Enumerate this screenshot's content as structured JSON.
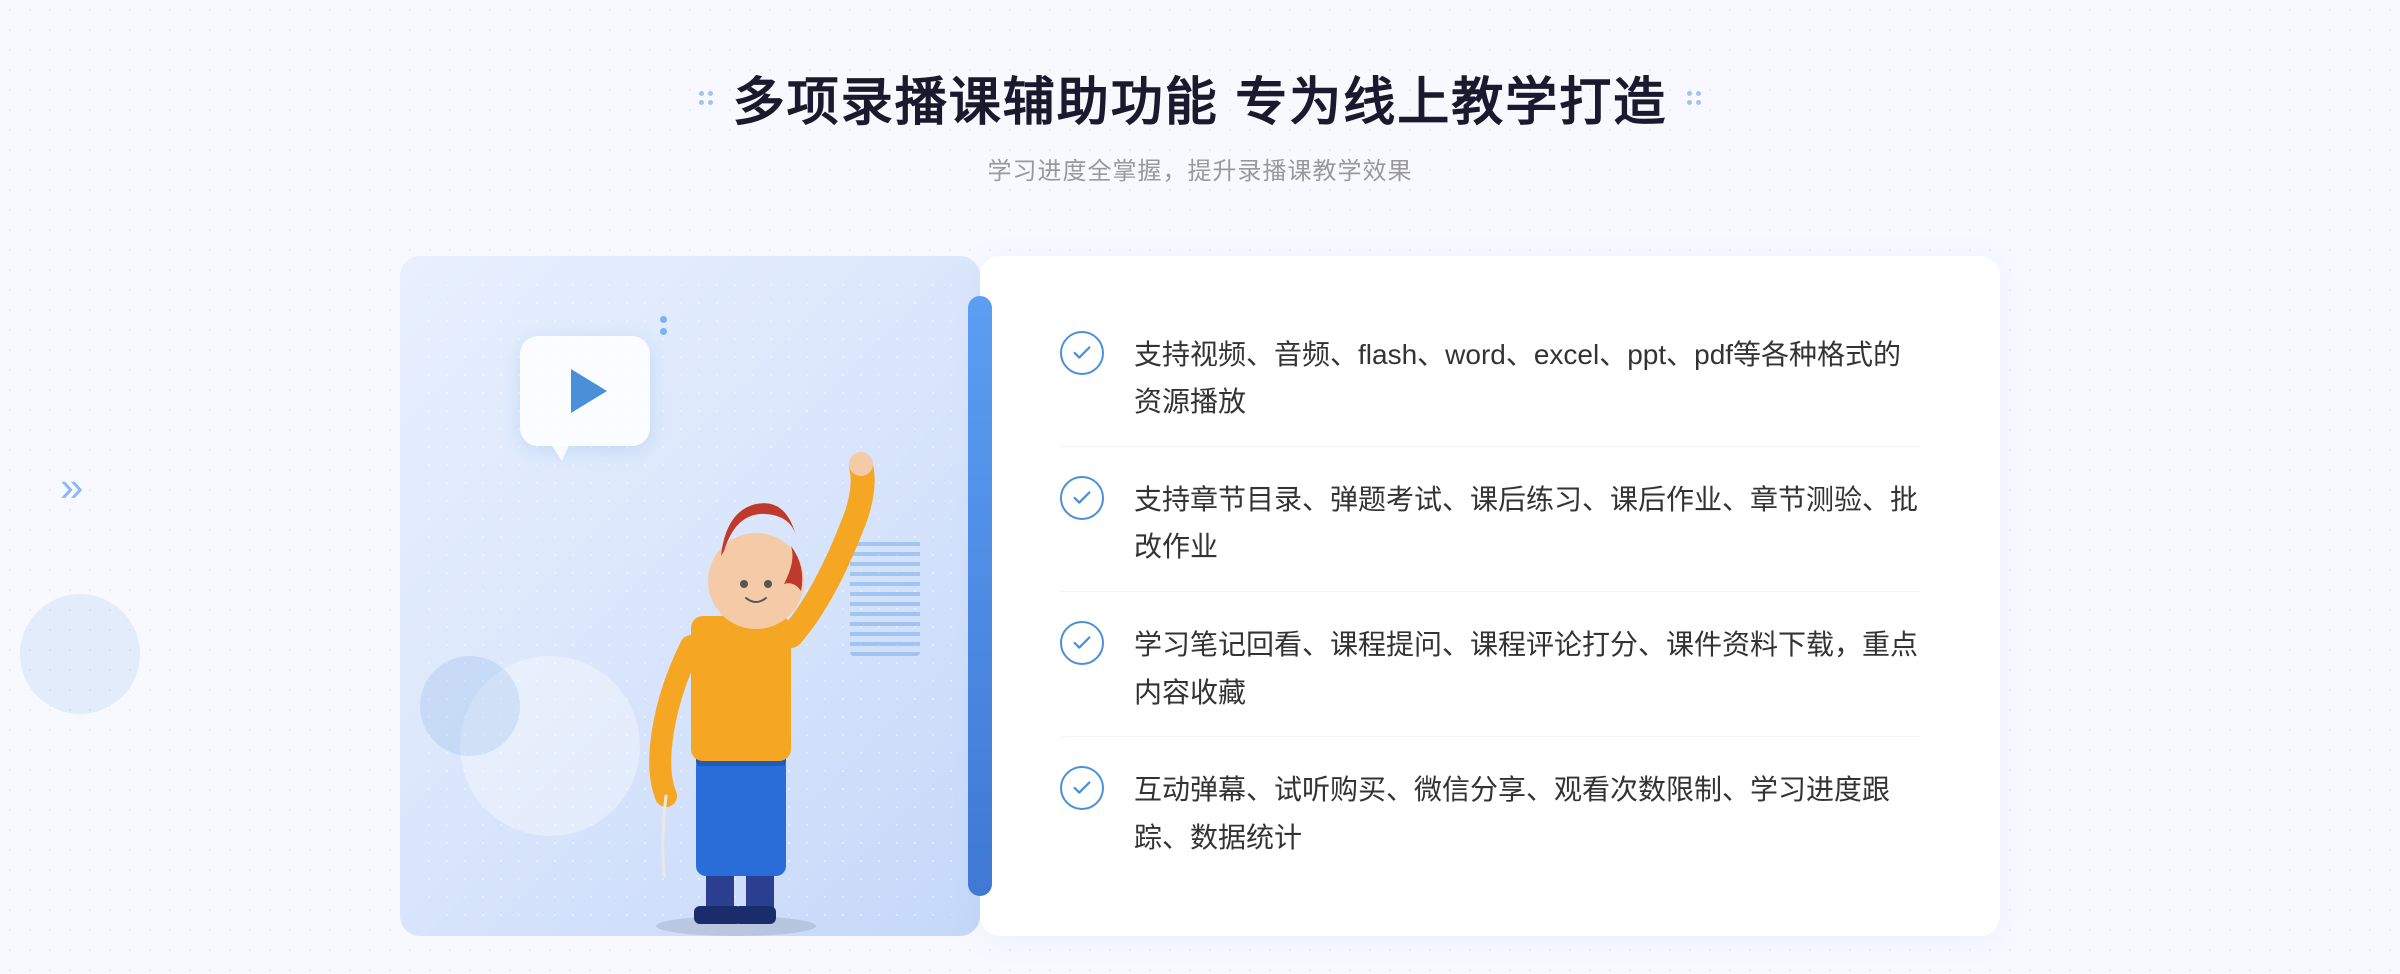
{
  "header": {
    "title": "多项录播课辅助功能 专为线上教学打造",
    "subtitle": "学习进度全掌握，提升录播课教学效果"
  },
  "features": [
    {
      "id": "feature-1",
      "text": "支持视频、音频、flash、word、excel、ppt、pdf等各种格式的资源播放"
    },
    {
      "id": "feature-2",
      "text": "支持章节目录、弹题考试、课后练习、课后作业、章节测验、批改作业"
    },
    {
      "id": "feature-3",
      "text": "学习笔记回看、课程提问、课程评论打分、课件资料下载，重点内容收藏"
    },
    {
      "id": "feature-4",
      "text": "互动弹幕、试听购买、微信分享、观看次数限制、学习进度跟踪、数据统计"
    }
  ],
  "colors": {
    "blue_primary": "#4a90d9",
    "blue_light": "#5b9ef4",
    "text_dark": "#1a1a2e",
    "text_gray": "#999999",
    "text_main": "#333333"
  }
}
